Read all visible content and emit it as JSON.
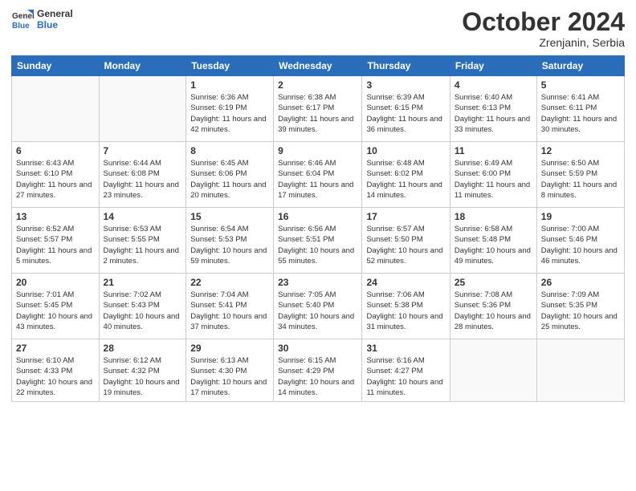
{
  "header": {
    "logo_general": "General",
    "logo_blue": "Blue",
    "month_title": "October 2024",
    "location": "Zrenjanin, Serbia"
  },
  "weekdays": [
    "Sunday",
    "Monday",
    "Tuesday",
    "Wednesday",
    "Thursday",
    "Friday",
    "Saturday"
  ],
  "weeks": [
    [
      {
        "day": "",
        "sunrise": "",
        "sunset": "",
        "daylight": ""
      },
      {
        "day": "",
        "sunrise": "",
        "sunset": "",
        "daylight": ""
      },
      {
        "day": "1",
        "sunrise": "Sunrise: 6:36 AM",
        "sunset": "Sunset: 6:19 PM",
        "daylight": "Daylight: 11 hours and 42 minutes."
      },
      {
        "day": "2",
        "sunrise": "Sunrise: 6:38 AM",
        "sunset": "Sunset: 6:17 PM",
        "daylight": "Daylight: 11 hours and 39 minutes."
      },
      {
        "day": "3",
        "sunrise": "Sunrise: 6:39 AM",
        "sunset": "Sunset: 6:15 PM",
        "daylight": "Daylight: 11 hours and 36 minutes."
      },
      {
        "day": "4",
        "sunrise": "Sunrise: 6:40 AM",
        "sunset": "Sunset: 6:13 PM",
        "daylight": "Daylight: 11 hours and 33 minutes."
      },
      {
        "day": "5",
        "sunrise": "Sunrise: 6:41 AM",
        "sunset": "Sunset: 6:11 PM",
        "daylight": "Daylight: 11 hours and 30 minutes."
      }
    ],
    [
      {
        "day": "6",
        "sunrise": "Sunrise: 6:43 AM",
        "sunset": "Sunset: 6:10 PM",
        "daylight": "Daylight: 11 hours and 27 minutes."
      },
      {
        "day": "7",
        "sunrise": "Sunrise: 6:44 AM",
        "sunset": "Sunset: 6:08 PM",
        "daylight": "Daylight: 11 hours and 23 minutes."
      },
      {
        "day": "8",
        "sunrise": "Sunrise: 6:45 AM",
        "sunset": "Sunset: 6:06 PM",
        "daylight": "Daylight: 11 hours and 20 minutes."
      },
      {
        "day": "9",
        "sunrise": "Sunrise: 6:46 AM",
        "sunset": "Sunset: 6:04 PM",
        "daylight": "Daylight: 11 hours and 17 minutes."
      },
      {
        "day": "10",
        "sunrise": "Sunrise: 6:48 AM",
        "sunset": "Sunset: 6:02 PM",
        "daylight": "Daylight: 11 hours and 14 minutes."
      },
      {
        "day": "11",
        "sunrise": "Sunrise: 6:49 AM",
        "sunset": "Sunset: 6:00 PM",
        "daylight": "Daylight: 11 hours and 11 minutes."
      },
      {
        "day": "12",
        "sunrise": "Sunrise: 6:50 AM",
        "sunset": "Sunset: 5:59 PM",
        "daylight": "Daylight: 11 hours and 8 minutes."
      }
    ],
    [
      {
        "day": "13",
        "sunrise": "Sunrise: 6:52 AM",
        "sunset": "Sunset: 5:57 PM",
        "daylight": "Daylight: 11 hours and 5 minutes."
      },
      {
        "day": "14",
        "sunrise": "Sunrise: 6:53 AM",
        "sunset": "Sunset: 5:55 PM",
        "daylight": "Daylight: 11 hours and 2 minutes."
      },
      {
        "day": "15",
        "sunrise": "Sunrise: 6:54 AM",
        "sunset": "Sunset: 5:53 PM",
        "daylight": "Daylight: 10 hours and 59 minutes."
      },
      {
        "day": "16",
        "sunrise": "Sunrise: 6:56 AM",
        "sunset": "Sunset: 5:51 PM",
        "daylight": "Daylight: 10 hours and 55 minutes."
      },
      {
        "day": "17",
        "sunrise": "Sunrise: 6:57 AM",
        "sunset": "Sunset: 5:50 PM",
        "daylight": "Daylight: 10 hours and 52 minutes."
      },
      {
        "day": "18",
        "sunrise": "Sunrise: 6:58 AM",
        "sunset": "Sunset: 5:48 PM",
        "daylight": "Daylight: 10 hours and 49 minutes."
      },
      {
        "day": "19",
        "sunrise": "Sunrise: 7:00 AM",
        "sunset": "Sunset: 5:46 PM",
        "daylight": "Daylight: 10 hours and 46 minutes."
      }
    ],
    [
      {
        "day": "20",
        "sunrise": "Sunrise: 7:01 AM",
        "sunset": "Sunset: 5:45 PM",
        "daylight": "Daylight: 10 hours and 43 minutes."
      },
      {
        "day": "21",
        "sunrise": "Sunrise: 7:02 AM",
        "sunset": "Sunset: 5:43 PM",
        "daylight": "Daylight: 10 hours and 40 minutes."
      },
      {
        "day": "22",
        "sunrise": "Sunrise: 7:04 AM",
        "sunset": "Sunset: 5:41 PM",
        "daylight": "Daylight: 10 hours and 37 minutes."
      },
      {
        "day": "23",
        "sunrise": "Sunrise: 7:05 AM",
        "sunset": "Sunset: 5:40 PM",
        "daylight": "Daylight: 10 hours and 34 minutes."
      },
      {
        "day": "24",
        "sunrise": "Sunrise: 7:06 AM",
        "sunset": "Sunset: 5:38 PM",
        "daylight": "Daylight: 10 hours and 31 minutes."
      },
      {
        "day": "25",
        "sunrise": "Sunrise: 7:08 AM",
        "sunset": "Sunset: 5:36 PM",
        "daylight": "Daylight: 10 hours and 28 minutes."
      },
      {
        "day": "26",
        "sunrise": "Sunrise: 7:09 AM",
        "sunset": "Sunset: 5:35 PM",
        "daylight": "Daylight: 10 hours and 25 minutes."
      }
    ],
    [
      {
        "day": "27",
        "sunrise": "Sunrise: 6:10 AM",
        "sunset": "Sunset: 4:33 PM",
        "daylight": "Daylight: 10 hours and 22 minutes."
      },
      {
        "day": "28",
        "sunrise": "Sunrise: 6:12 AM",
        "sunset": "Sunset: 4:32 PM",
        "daylight": "Daylight: 10 hours and 19 minutes."
      },
      {
        "day": "29",
        "sunrise": "Sunrise: 6:13 AM",
        "sunset": "Sunset: 4:30 PM",
        "daylight": "Daylight: 10 hours and 17 minutes."
      },
      {
        "day": "30",
        "sunrise": "Sunrise: 6:15 AM",
        "sunset": "Sunset: 4:29 PM",
        "daylight": "Daylight: 10 hours and 14 minutes."
      },
      {
        "day": "31",
        "sunrise": "Sunrise: 6:16 AM",
        "sunset": "Sunset: 4:27 PM",
        "daylight": "Daylight: 10 hours and 11 minutes."
      },
      {
        "day": "",
        "sunrise": "",
        "sunset": "",
        "daylight": ""
      },
      {
        "day": "",
        "sunrise": "",
        "sunset": "",
        "daylight": ""
      }
    ]
  ]
}
